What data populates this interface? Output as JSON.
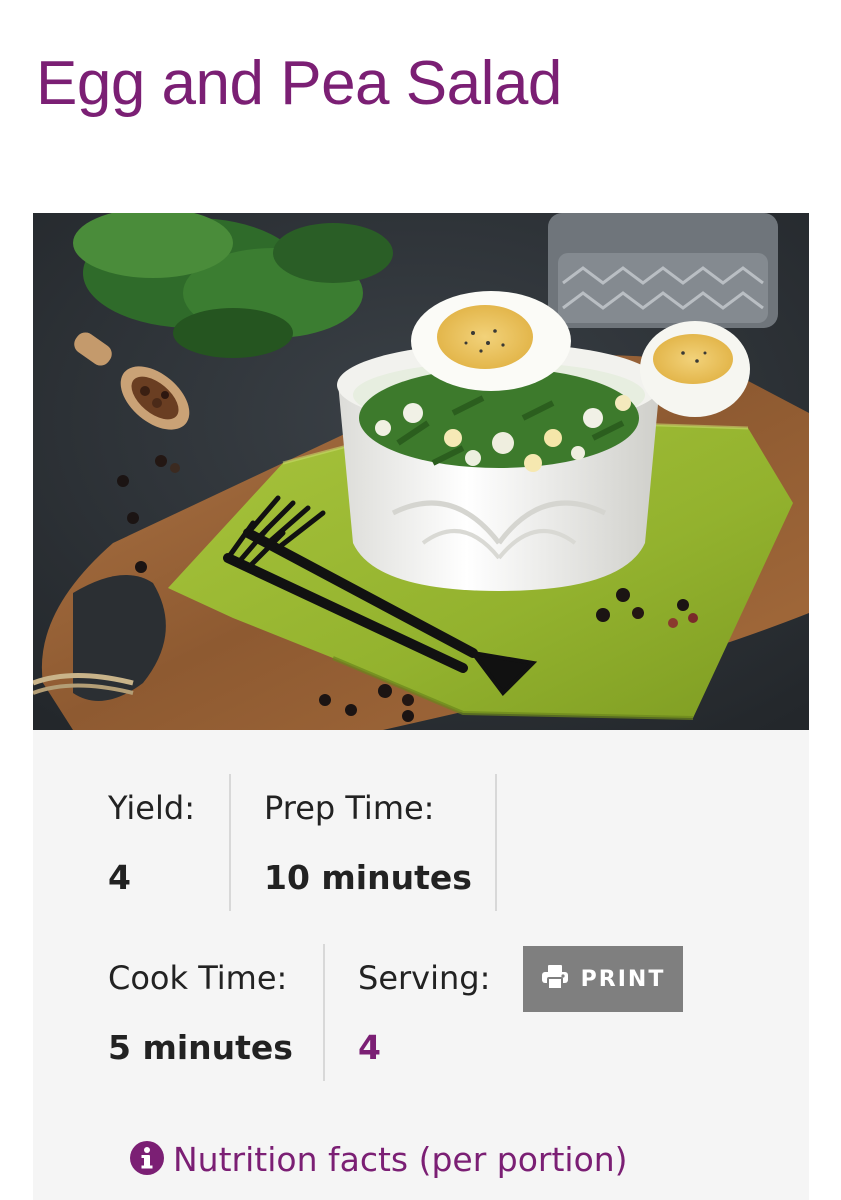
{
  "recipe": {
    "title": "Egg and Pea Salad",
    "image_alt": "Egg and Pea Salad"
  },
  "meta": {
    "yield_label": "Yield:",
    "yield_value": "4",
    "prep_label": "Prep Time:",
    "prep_value": "10 minutes",
    "cook_label": "Cook Time:",
    "cook_value": "5 minutes",
    "serving_label": "Serving:",
    "serving_value": "4"
  },
  "actions": {
    "print_label": "PRINT",
    "print_icon": "printer-icon"
  },
  "nutrition": {
    "link_label": "Nutrition facts (per portion)",
    "icon": "info-circle-icon"
  },
  "colors": {
    "accent": "#7b1f74",
    "panel_bg": "#f5f5f5",
    "button_bg": "#7f7f7f",
    "text": "#222222"
  }
}
